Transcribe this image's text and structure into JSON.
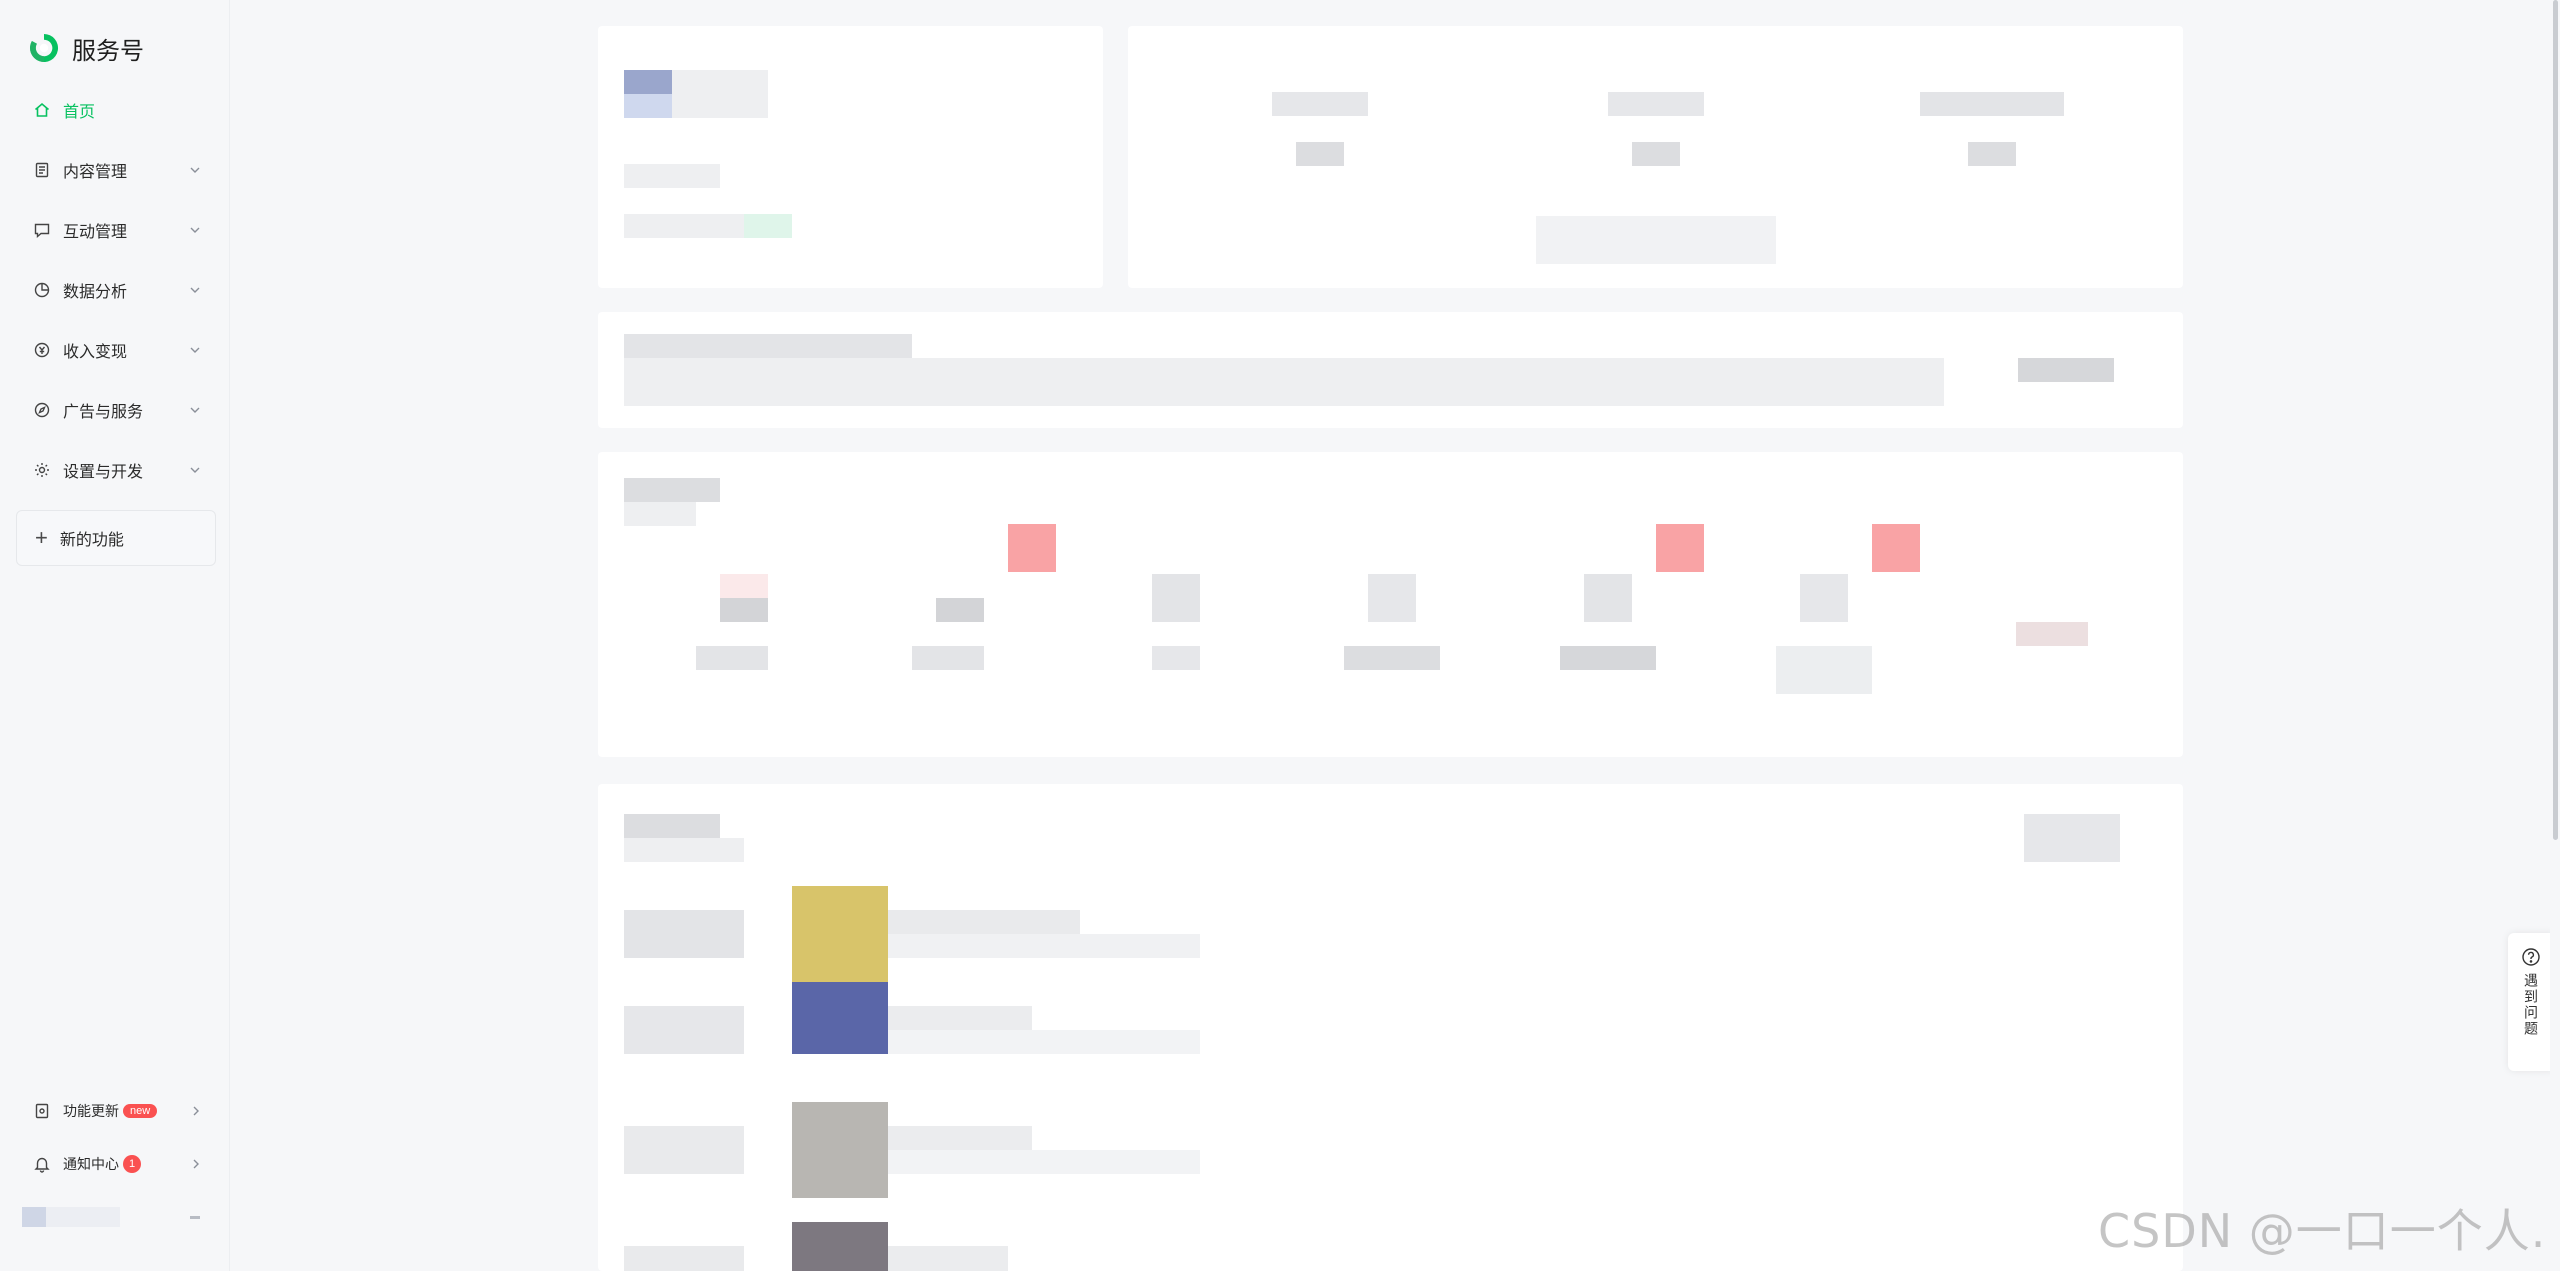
{
  "brand": {
    "name": "服务号",
    "accent": "#07c160"
  },
  "nav": {
    "items": [
      {
        "label": "首页",
        "icon": "home-icon",
        "active": true
      },
      {
        "label": "内容管理",
        "icon": "document-icon",
        "expandable": true
      },
      {
        "label": "互动管理",
        "icon": "chat-icon",
        "expandable": true
      },
      {
        "label": "数据分析",
        "icon": "pie-chart-icon",
        "expandable": true
      },
      {
        "label": "收入变现",
        "icon": "coin-icon",
        "expandable": true
      },
      {
        "label": "广告与服务",
        "icon": "compass-icon",
        "expandable": true
      },
      {
        "label": "设置与开发",
        "icon": "gear-icon",
        "expandable": true
      }
    ],
    "new_features_label": "新的功能"
  },
  "bottom": {
    "updates_label": "功能更新",
    "updates_badge": "new",
    "notify_label": "通知中心",
    "notify_count": "1"
  },
  "help": {
    "label": "遇到问题"
  },
  "watermark": "CSDN @一口一个人."
}
